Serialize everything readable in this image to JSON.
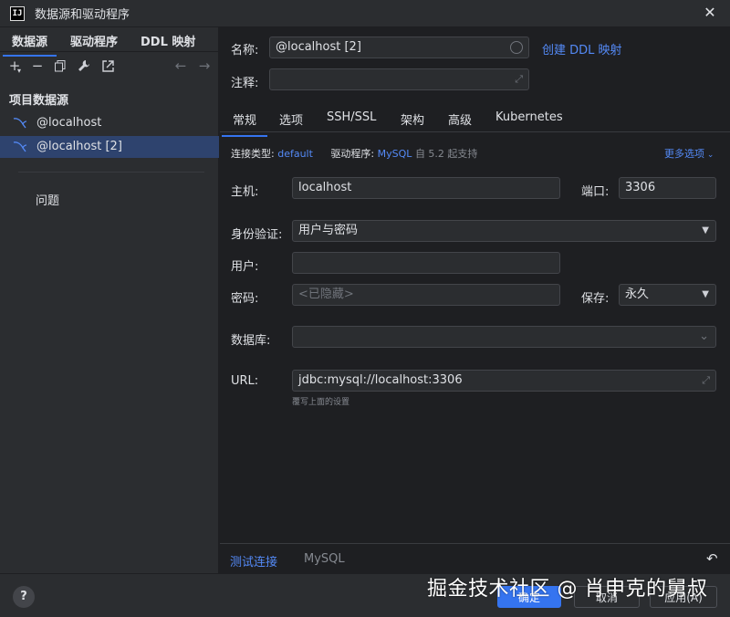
{
  "window": {
    "title": "数据源和驱动程序"
  },
  "left": {
    "tabs": [
      "数据源",
      "驱动程序",
      "DDL 映射"
    ],
    "section": "项目数据源",
    "items": [
      "@localhost",
      "@localhost [2]"
    ],
    "problems": "问题"
  },
  "form": {
    "name_label": "名称:",
    "name_value": "@localhost [2]",
    "create_ddl_link": "创建 DDL 映射",
    "comment_label": "注释:",
    "tabs": [
      "常规",
      "选项",
      "SSH/SSL",
      "架构",
      "高级",
      "Kubernetes"
    ],
    "conn_type_label": "连接类型:",
    "conn_type_value": "default",
    "driver_label": "驱动程序:",
    "driver_value": "MySQL",
    "driver_note": "自 5.2 起支持",
    "more_options": "更多选项",
    "host_label": "主机:",
    "host_value": "localhost",
    "port_label": "端口:",
    "port_value": "3306",
    "auth_label": "身份验证:",
    "auth_value": "用户与密码",
    "user_label": "用户:",
    "user_value": "",
    "password_label": "密码:",
    "password_placeholder": "<已隐藏>",
    "save_label": "保存:",
    "save_value": "永久",
    "database_label": "数据库:",
    "database_value": "",
    "url_label": "URL:",
    "url_value": "jdbc:mysql://localhost:3306",
    "url_hint": "覆写上面的设置",
    "test_connection": "测试连接",
    "driver_footer": "MySQL"
  },
  "footer": {
    "ok": "确定",
    "cancel": "取消",
    "apply": "应用(A)",
    "help": "?"
  },
  "watermark": "掘金技术社区 @ 肖申克的舅叔"
}
